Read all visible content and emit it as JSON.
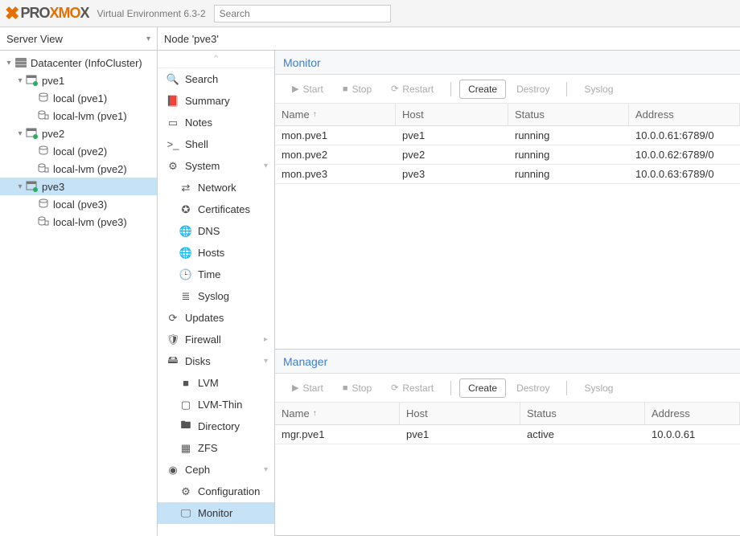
{
  "header": {
    "product": "PROXMOX",
    "ve_text": "Virtual Environment 6.3-2",
    "search_placeholder": "Search"
  },
  "subbar": {
    "view_label": "Server View",
    "breadcrumb": "Node 'pve3'"
  },
  "tree": {
    "root_label": "Datacenter (InfoCluster)",
    "nodes": [
      {
        "name": "pve1",
        "storages": [
          {
            "label": "local (pve1)"
          },
          {
            "label": "local-lvm (pve1)"
          }
        ],
        "selected": false
      },
      {
        "name": "pve2",
        "storages": [
          {
            "label": "local (pve2)"
          },
          {
            "label": "local-lvm (pve2)"
          }
        ],
        "selected": false
      },
      {
        "name": "pve3",
        "storages": [
          {
            "label": "local (pve3)"
          },
          {
            "label": "local-lvm (pve3)"
          }
        ],
        "selected": true
      }
    ]
  },
  "nav": {
    "search": "Search",
    "summary": "Summary",
    "notes": "Notes",
    "shell": "Shell",
    "system": "System",
    "network": "Network",
    "certificates": "Certificates",
    "dns": "DNS",
    "hosts": "Hosts",
    "time": "Time",
    "syslog": "Syslog",
    "updates": "Updates",
    "firewall": "Firewall",
    "disks": "Disks",
    "lvm": "LVM",
    "lvmthin": "LVM-Thin",
    "directory": "Directory",
    "zfs": "ZFS",
    "ceph": "Ceph",
    "configuration": "Configuration",
    "monitor": "Monitor"
  },
  "monitor_panel": {
    "title": "Monitor",
    "toolbar": {
      "start": "Start",
      "stop": "Stop",
      "restart": "Restart",
      "create": "Create",
      "destroy": "Destroy",
      "syslog": "Syslog"
    },
    "columns": {
      "name": "Name",
      "host": "Host",
      "status": "Status",
      "address": "Address"
    },
    "rows": [
      {
        "name": "mon.pve1",
        "host": "pve1",
        "status": "running",
        "address": "10.0.0.61:6789/0"
      },
      {
        "name": "mon.pve2",
        "host": "pve2",
        "status": "running",
        "address": "10.0.0.62:6789/0"
      },
      {
        "name": "mon.pve3",
        "host": "pve3",
        "status": "running",
        "address": "10.0.0.63:6789/0"
      }
    ]
  },
  "manager_panel": {
    "title": "Manager",
    "toolbar": {
      "start": "Start",
      "stop": "Stop",
      "restart": "Restart",
      "create": "Create",
      "destroy": "Destroy",
      "syslog": "Syslog"
    },
    "columns": {
      "name": "Name",
      "host": "Host",
      "status": "Status",
      "address": "Address"
    },
    "rows": [
      {
        "name": "mgr.pve1",
        "host": "pve1",
        "status": "active",
        "address": "10.0.0.61"
      }
    ]
  }
}
